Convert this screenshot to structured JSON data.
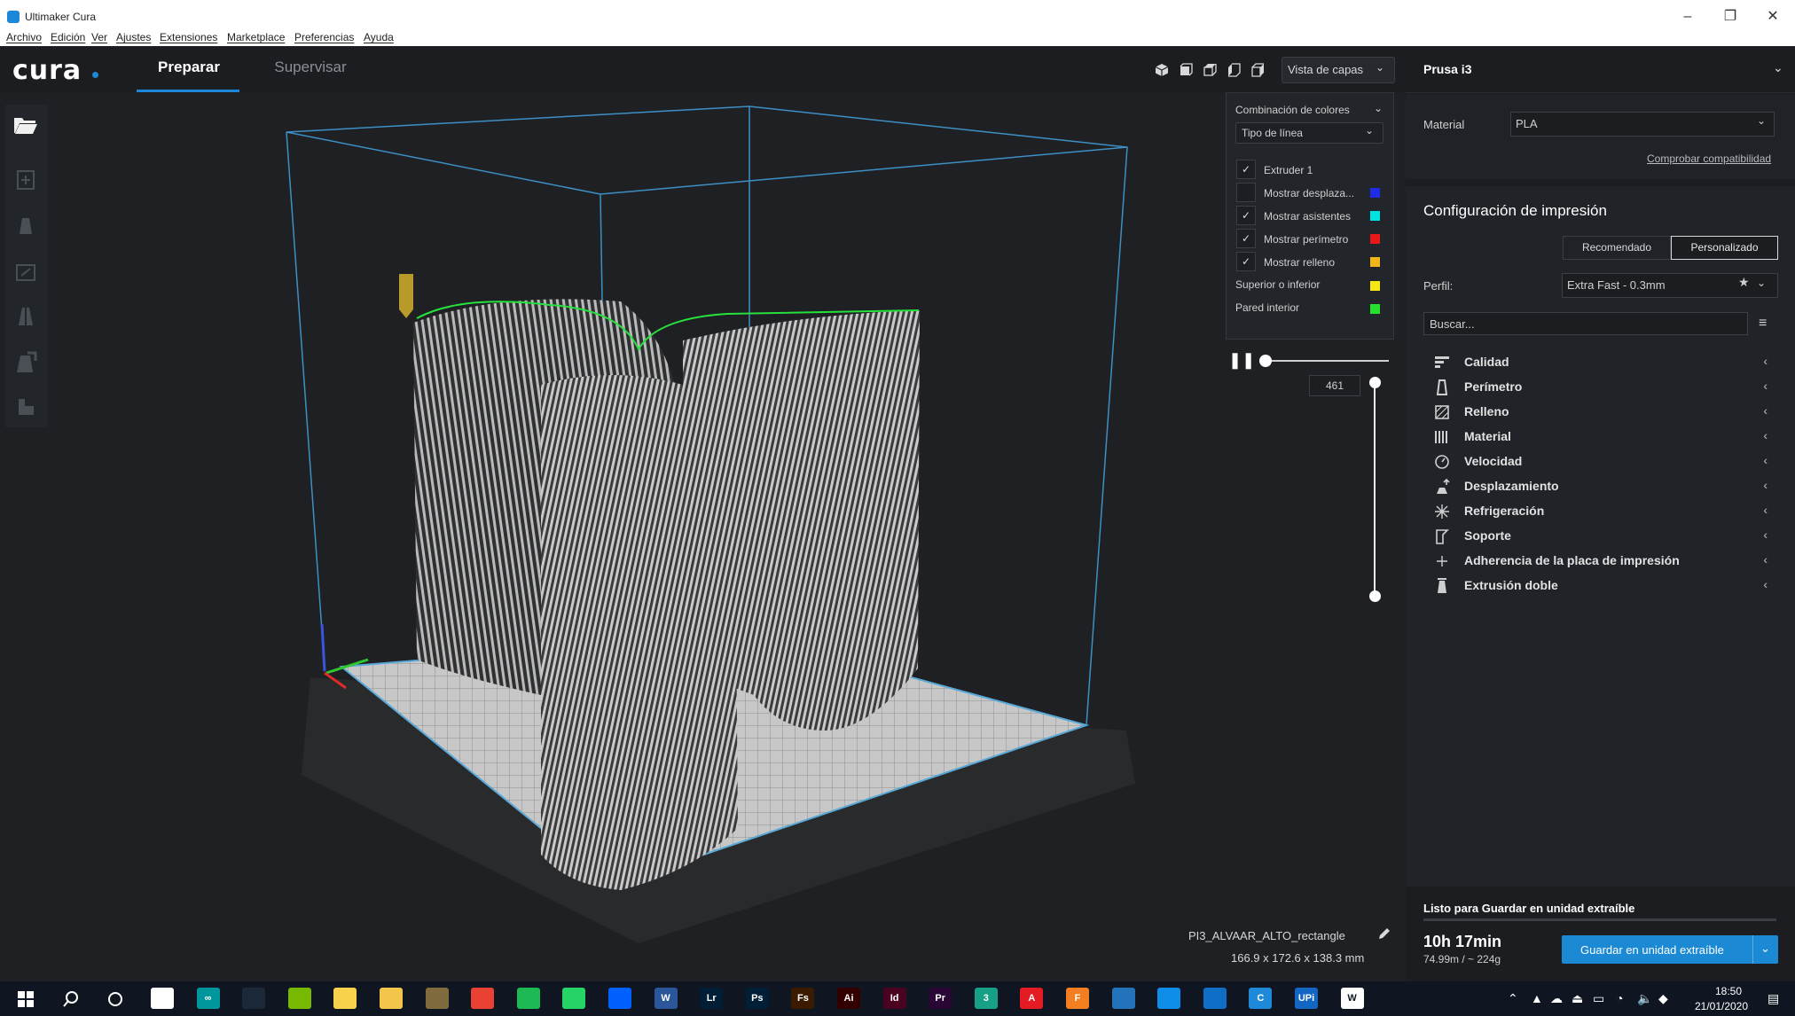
{
  "window": {
    "title": "Ultimaker Cura",
    "controls": {
      "minimize": "–",
      "restore": "❐",
      "close": "✕"
    }
  },
  "menu": [
    "Archivo",
    "Edición",
    "Ver",
    "Ajustes",
    "Extensiones",
    "Marketplace",
    "Preferencias",
    "Ayuda"
  ],
  "header": {
    "logo": "cura",
    "tabs": [
      {
        "label": "Preparar",
        "active": true
      },
      {
        "label": "Supervisar",
        "active": false
      }
    ],
    "view_icons": [
      "3d-view-icon",
      "front-view-icon",
      "top-view-icon",
      "left-view-icon",
      "right-view-icon"
    ],
    "view_mode": "Vista de capas"
  },
  "left_toolbar": [
    "open-folder-icon",
    "move-tool-icon",
    "scale-tool-icon",
    "rotate-tool-icon",
    "mirror-tool-icon",
    "per-model-settings-icon",
    "support-blocker-icon"
  ],
  "layer_view": {
    "color_scheme_label": "Combinación de colores",
    "color_scheme_value": "Tipo de línea",
    "rows": [
      {
        "label": "Extruder 1",
        "checked": true,
        "color": ""
      },
      {
        "label": "Mostrar desplaza...",
        "checked": false,
        "color": "#1f2be6"
      },
      {
        "label": "Mostrar asistentes",
        "checked": true,
        "color": "#00e1e1"
      },
      {
        "label": "Mostrar perímetro",
        "checked": true,
        "color": "#e81818"
      },
      {
        "label": "Mostrar relleno",
        "checked": true,
        "color": "#f2b51a"
      }
    ],
    "legend": [
      {
        "label": "Superior o inferior",
        "color": "#f5e614"
      },
      {
        "label": "Pared interior",
        "color": "#27e02d"
      }
    ],
    "current_layer": "461"
  },
  "model": {
    "file_name": "PI3_ALVAAR_ALTO_rectangle",
    "dimensions": "166.9 x 172.6 x 138.3 mm"
  },
  "printer": {
    "name": "Prusa i3",
    "material_label": "Material",
    "material_value": "PLA",
    "compat_link": "Comprobar compatibilidad"
  },
  "print_settings": {
    "title": "Configuración de impresión",
    "mode_buttons": [
      "Recomendado",
      "Personalizado"
    ],
    "profile_label": "Perfil:",
    "profile_value": "Extra Fast - 0.3mm",
    "search_placeholder": "Buscar...",
    "categories": [
      {
        "label": "Calidad",
        "icon": "quality-icon"
      },
      {
        "label": "Perímetro",
        "icon": "shell-icon"
      },
      {
        "label": "Relleno",
        "icon": "infill-icon"
      },
      {
        "label": "Material",
        "icon": "material-icon"
      },
      {
        "label": "Velocidad",
        "icon": "speed-icon"
      },
      {
        "label": "Desplazamiento",
        "icon": "travel-icon"
      },
      {
        "label": "Refrigeración",
        "icon": "cooling-icon"
      },
      {
        "label": "Soporte",
        "icon": "support-icon"
      },
      {
        "label": "Adherencia de la placa de impresión",
        "icon": "adhesion-icon"
      },
      {
        "label": "Extrusión doble",
        "icon": "dual-extrusion-icon"
      }
    ]
  },
  "output": {
    "status": "Listo para Guardar en unidad extraíble",
    "time": "10h 17min",
    "usage": "74.99m / ~ 224g",
    "save_button": "Guardar en unidad extraíble"
  },
  "taskbar": {
    "apps": [
      {
        "name": "mail-app",
        "label": "",
        "color": "#ffffff"
      },
      {
        "name": "arduino-app",
        "label": "∞",
        "color": "#00979c"
      },
      {
        "name": "steam-app",
        "label": "",
        "color": "#1b2838"
      },
      {
        "name": "nvidia-app",
        "label": "",
        "color": "#76b900"
      },
      {
        "name": "sticky-notes-app",
        "label": "",
        "color": "#f7d24a"
      },
      {
        "name": "file-explorer-app",
        "label": "",
        "color": "#f3c54a"
      },
      {
        "name": "store-app",
        "label": "",
        "color": "#7f6b3e"
      },
      {
        "name": "chrome-app",
        "label": "",
        "color": "#e94235"
      },
      {
        "name": "spotify-app",
        "label": "",
        "color": "#1db954"
      },
      {
        "name": "whatsapp-app",
        "label": "",
        "color": "#25d366"
      },
      {
        "name": "dropbox-app",
        "label": "",
        "color": "#0061ff"
      },
      {
        "name": "word-app",
        "label": "W",
        "color": "#2b579a"
      },
      {
        "name": "lightroom-app",
        "label": "Lr",
        "color": "#001e36"
      },
      {
        "name": "photoshop-app",
        "label": "Ps",
        "color": "#001e36"
      },
      {
        "name": "fuse-app",
        "label": "Fs",
        "color": "#3a1b00"
      },
      {
        "name": "illustrator-app",
        "label": "Ai",
        "color": "#330000"
      },
      {
        "name": "indesign-app",
        "label": "Id",
        "color": "#49021f"
      },
      {
        "name": "premiere-app",
        "label": "Pr",
        "color": "#2a0634"
      },
      {
        "name": "3dsmax-app",
        "label": "3",
        "color": "#16a085"
      },
      {
        "name": "autocad-app",
        "label": "A",
        "color": "#e51b24"
      },
      {
        "name": "fusion-app",
        "label": "F",
        "color": "#f47f20"
      },
      {
        "name": "network-app",
        "label": "",
        "color": "#2273b9"
      },
      {
        "name": "teamviewer-app",
        "label": "",
        "color": "#0e8ee9"
      },
      {
        "name": "filter-app",
        "label": "",
        "color": "#0f6fc6"
      },
      {
        "name": "cura-app",
        "label": "C",
        "color": "#1e89d9"
      },
      {
        "name": "upi-app",
        "label": "UPi",
        "color": "#1466c5"
      },
      {
        "name": "web-app",
        "label": "W",
        "color": "#ffffff"
      }
    ],
    "time": "18:50",
    "date": "21/01/2020"
  }
}
